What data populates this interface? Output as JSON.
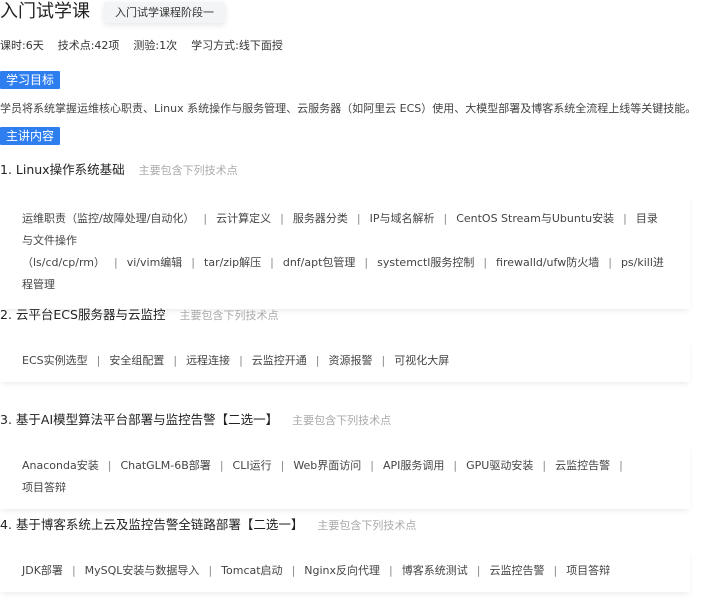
{
  "course": {
    "title": "入门试学课",
    "stage_tag": "入门试学课程阶段一",
    "meta": [
      "课时:6天",
      "技术点:42项",
      "测验:1次",
      "学习方式:线下面授"
    ]
  },
  "goal": {
    "badge": "学习目标",
    "text": "学员将系统掌握运维核心职责、Linux 系统操作与服务管理、云服务器（如阿里云 ECS）使用、大模型部署及博客系统全流程上线等关键技能。"
  },
  "content": {
    "badge": "主讲内容",
    "modules": [
      {
        "title": "1. Linux操作系统基础",
        "subtitle": "主要包含下列技术点",
        "topics": [
          "运维职责（监控/故障处理/自动化）",
          "云计算定义",
          "服务器分类",
          "IP与域名解析",
          "CentOS Stream与Ubuntu安装",
          "目录与文件操作（ls/cd/cp/rm）",
          "vi/vim编辑",
          "tar/zip解压",
          "dnf/apt包管理",
          "systemctl服务控制",
          "firewalld/ufw防火墙",
          "ps/kill进程管理"
        ]
      },
      {
        "title": "2. 云平台ECS服务器与云监控",
        "subtitle": "主要包含下列技术点",
        "topics": [
          "ECS实例选型",
          "安全组配置",
          "远程连接",
          "云监控开通",
          "资源报警",
          "可视化大屏"
        ]
      },
      {
        "title": "3. 基于AI模型算法平台部署与监控告警【二选一】",
        "subtitle": "主要包含下列技术点",
        "topics": [
          "Anaconda安装",
          "ChatGLM-6B部署",
          "CLI运行",
          "Web界面访问",
          "API服务调用",
          "GPU驱动安装",
          "云监控告警",
          "项目答辩"
        ]
      },
      {
        "title": "4. 基于博客系统上云及监控告警全链路部署【二选一】",
        "subtitle": "主要包含下列技术点",
        "topics": [
          "JDK部署",
          "MySQL安装与数据导入",
          "Tomcat启动",
          "Nginx反向代理",
          "博客系统测试",
          "云监控告警",
          "项目答辩"
        ]
      }
    ]
  }
}
